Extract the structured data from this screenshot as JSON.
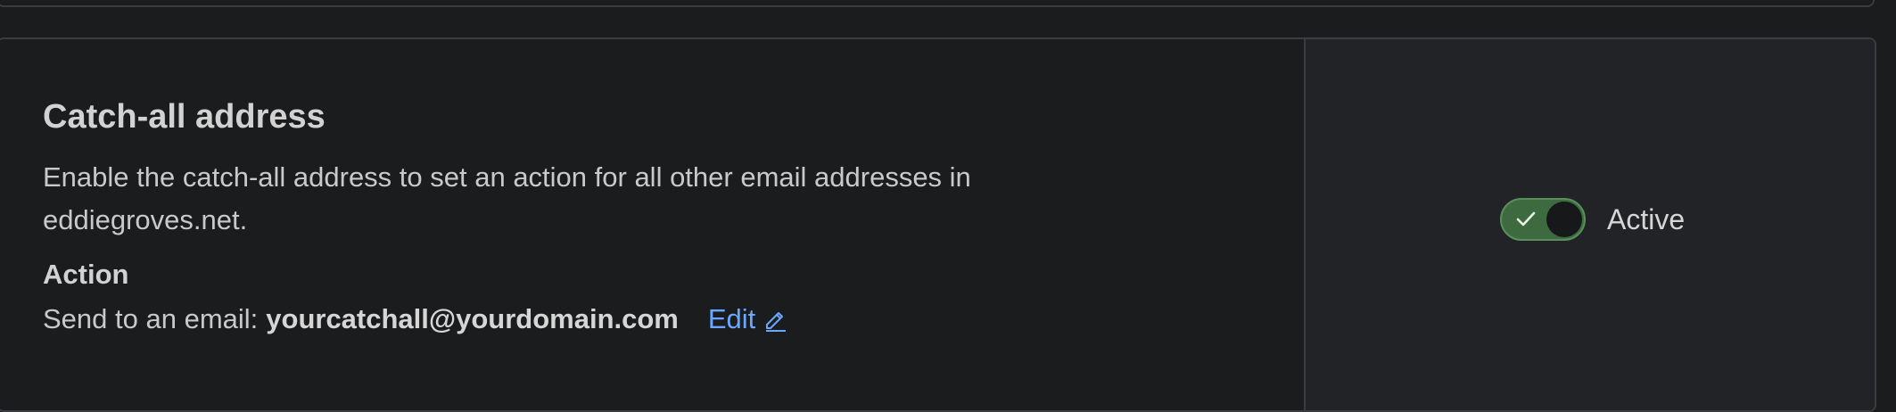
{
  "catch_all": {
    "title": "Catch-all address",
    "description": "Enable the catch-all address to set an action for all other email addresses in eddiegroves.net.",
    "action_label": "Action",
    "action_prefix": "Send to an email:",
    "action_email": "yourcatchall@yourdomain.com",
    "edit_label": "Edit",
    "toggle_state": "on",
    "toggle_label": "Active"
  },
  "colors": {
    "background": "#1b1c1e",
    "right_pane": "#222326",
    "toggle_on": "#3d6a3f",
    "link": "#6aa8ff"
  }
}
